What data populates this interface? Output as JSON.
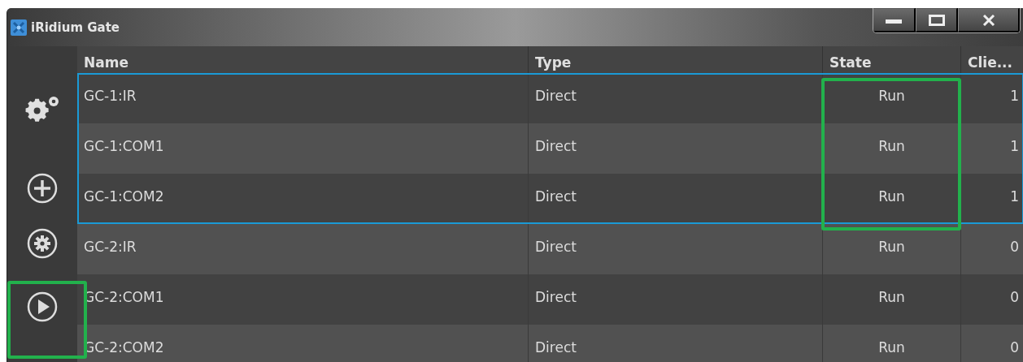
{
  "window": {
    "title": "iRidium Gate"
  },
  "toolbar": [
    {
      "kind": "gears",
      "highlighted": false
    },
    {
      "kind": "add",
      "highlighted": false
    },
    {
      "kind": "settings",
      "highlighted": false
    },
    {
      "kind": "play",
      "highlighted": true
    }
  ],
  "table": {
    "columns": [
      "Name",
      "Type",
      "State",
      "Clie..."
    ],
    "rows": [
      {
        "name": "GC-1:IR",
        "type": "Direct",
        "state": "Run",
        "column_4": "1",
        "selected": true,
        "state_highlighted": true
      },
      {
        "name": "GC-1:COM1",
        "type": "Direct",
        "state": "Run",
        "column_4": "1",
        "selected": true,
        "state_highlighted": true
      },
      {
        "name": "GC-1:COM2",
        "type": "Direct",
        "state": "Run",
        "column_4": "1",
        "selected": true,
        "state_highlighted": true
      },
      {
        "name": "GC-2:IR",
        "type": "Direct",
        "state": "Run",
        "column_4": "0",
        "selected": false,
        "state_highlighted": false
      },
      {
        "name": "GC-2:COM1",
        "type": "Direct",
        "state": "Run",
        "column_4": "0",
        "selected": false,
        "state_highlighted": false
      },
      {
        "name": "GC-2:COM2",
        "type": "Direct",
        "state": "Run",
        "column_4": "0",
        "selected": false,
        "state_highlighted": false
      }
    ]
  }
}
